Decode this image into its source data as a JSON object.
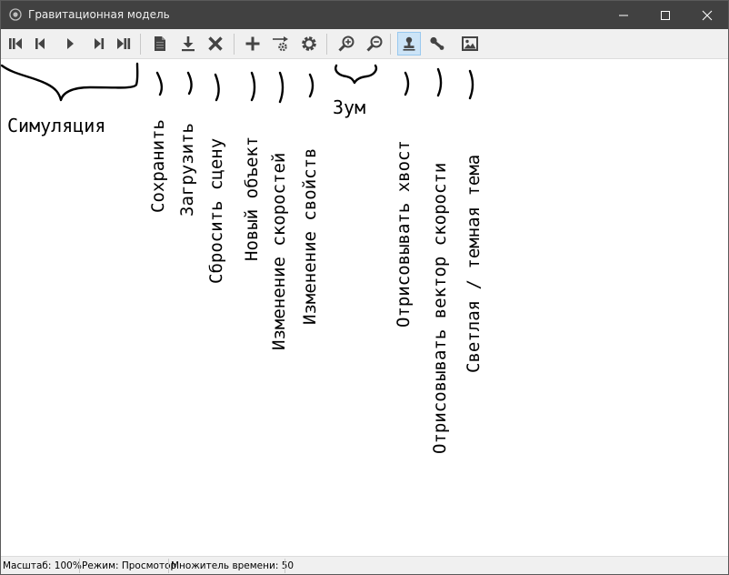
{
  "window": {
    "title": "Гравитационная модель",
    "icon": "app-orbit-icon"
  },
  "toolbar": {
    "groups": [
      [
        "to-start-icon",
        "step-back-icon",
        "play-icon",
        "step-forward-icon",
        "to-end-icon"
      ],
      [
        "save-file-icon",
        "download-icon",
        "close-x-icon"
      ],
      [
        "plus-icon",
        "velocity-gear-icon",
        "gear-icon"
      ],
      [
        "zoom-in-icon",
        "zoom-out-icon"
      ],
      [
        "stamp-icon",
        "vector-icon",
        "image-icon"
      ]
    ],
    "active_button": "draw-tail-button",
    "active_color": "#cce4f7"
  },
  "annotations": {
    "simulation": "Симуляция",
    "save": "Сохранить",
    "load": "Загрузить",
    "reset_scene": "Сбросить сцену",
    "new_object": "Новый объект",
    "change_velocities": "Изменение скоростей",
    "change_properties": "Изменение свойств",
    "zoom": "Зум",
    "draw_tail": "Отрисовывать хвост",
    "draw_velocity_vector": "Отрисовывать вектор скорости",
    "theme": "Светлая / темная тема"
  },
  "status": {
    "scale": "Масштаб: 100%",
    "mode": "Режим: Просмотор",
    "time_multiplier": "Множитель времени: 50"
  },
  "colors": {
    "titlebar": "#414141",
    "toolbar": "#f0f0f0",
    "icon": "#444444"
  }
}
